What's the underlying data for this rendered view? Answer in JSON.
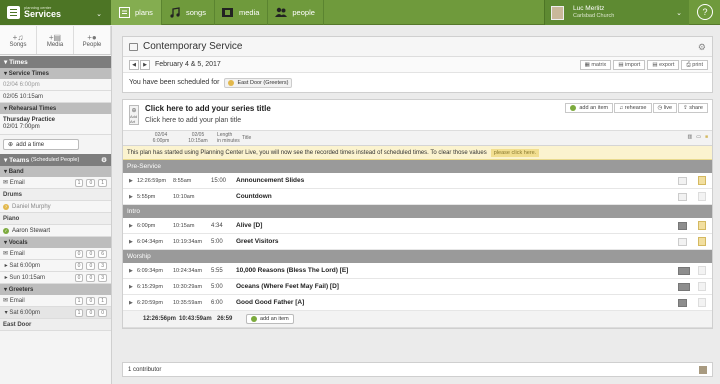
{
  "brand": {
    "small": "planning center",
    "name": "Services"
  },
  "nav": [
    {
      "label": "plans",
      "icon": "plans-icon",
      "active": true
    },
    {
      "label": "songs",
      "icon": "music-note-icon",
      "active": false
    },
    {
      "label": "media",
      "icon": "film-icon",
      "active": false
    },
    {
      "label": "people",
      "icon": "people-icon",
      "active": false
    }
  ],
  "user": {
    "name": "Luc Merlitz",
    "org": "Carlsbad Church"
  },
  "help": "?",
  "sidebar": {
    "tabs": [
      "Songs",
      "Media",
      "People"
    ],
    "times_label": "Times",
    "service_times_label": "Service Times",
    "service_times": [
      "02/04 6:00pm",
      "02/05 10:15am"
    ],
    "rehearsal_label": "Rehearsal Times",
    "practice_name": "Thursday Practice",
    "practice_time": "02/01 7:00pm",
    "add_time": "add a time",
    "teams_label": "Teams",
    "teams_sub": "(Scheduled People)",
    "band_label": "Band",
    "email": "Email",
    "band_counts": [
      "1",
      "0",
      "1"
    ],
    "drums_label": "Drums",
    "drummer": "Daniel Murphy",
    "piano_label": "Piano",
    "pianist": "Aaron Stewart",
    "vocals_label": "Vocals",
    "vocals_counts": [
      "0",
      "0",
      "6"
    ],
    "vocal_sat": "Sat 6:00pm",
    "vocal_sat_counts": [
      "0",
      "0",
      "3"
    ],
    "vocal_sun": "Sun 10:15am",
    "vocal_sun_counts": [
      "0",
      "0",
      "3"
    ],
    "greeters_label": "Greeters",
    "greeters_counts": [
      "1",
      "0",
      "1"
    ],
    "greeters_sat": "Sat 6:00pm",
    "greeters_sat_counts": [
      "1",
      "0",
      "0"
    ],
    "east_door": "East Door"
  },
  "plan": {
    "title": "Contemporary Service",
    "dates": "February 4 & 5, 2017",
    "tools": [
      "matrix",
      "import",
      "export",
      "print"
    ],
    "scheduled_text": "You have been scheduled for",
    "position": "East Door (Greeters)",
    "series_title": "Click here to add your series title",
    "plan_title": "Click here to add your plan title",
    "add_art": "Add Art",
    "buttons": [
      "add an item",
      "rehearse",
      "live",
      "share"
    ],
    "col_date1": "02/04",
    "col_time1": "6:00pm",
    "col_date2": "02/05",
    "col_time2": "10:15am",
    "col_length": "Length",
    "col_length2": "in minutes",
    "col_title": "Title",
    "notice": "This plan has started using Planning Center Live, you will now see the recorded times instead of scheduled times. To clear those values",
    "notice_link": "please click here.",
    "sections": [
      {
        "name": "Pre-Service",
        "items": [
          {
            "t1": "12:26:59pm",
            "t2": "8:55am",
            "len": "15:00",
            "title": "Announcement Slides",
            "dark": false,
            "note": true
          },
          {
            "t1": "5:55pm",
            "t2": "10:10am",
            "len": "",
            "title": "Countdown",
            "dark": false,
            "note": false
          }
        ]
      },
      {
        "name": "Intro",
        "items": [
          {
            "t1": "6:00pm",
            "t2": "10:15am",
            "len": "4:34",
            "title": "Alive [D]",
            "dark": true,
            "note": true
          },
          {
            "t1": "6:04:34pm",
            "t2": "10:19:34am",
            "len": "5:00",
            "title": "Greet Visitors",
            "dark": false,
            "note": true
          }
        ]
      },
      {
        "name": "Worship",
        "items": [
          {
            "t1": "6:09:34pm",
            "t2": "10:24:34am",
            "len": "5:55",
            "title": "10,000 Reasons (Bless The Lord) [E]",
            "dark": true,
            "note": false
          },
          {
            "t1": "6:15:29pm",
            "t2": "10:30:29am",
            "len": "5:00",
            "title": "Oceans (Where Feet May Fail) [D]",
            "dark": true,
            "note": false
          },
          {
            "t1": "6:20:59pm",
            "t2": "10:35:59am",
            "len": "6:00",
            "title": "Good Good Father [A]",
            "dark": true,
            "note": false
          }
        ]
      }
    ],
    "total_t1": "12:26:56pm",
    "total_t2": "10:43:59am",
    "total_len": "26:59",
    "add_item": "add an item",
    "contributors": "1 contributor"
  }
}
